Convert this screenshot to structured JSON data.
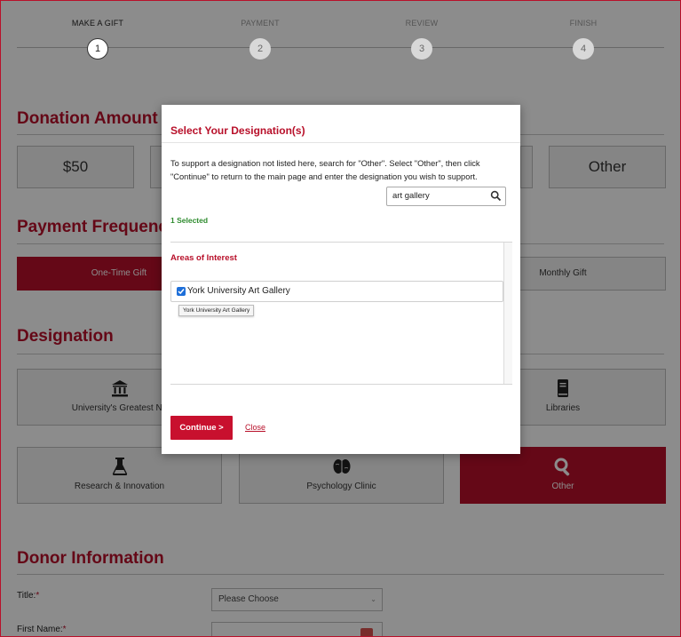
{
  "steps": [
    {
      "label": "MAKE A GIFT",
      "number": "1",
      "state": "active"
    },
    {
      "label": "PAYMENT",
      "number": "2",
      "state": "inactive"
    },
    {
      "label": "REVIEW",
      "number": "3",
      "state": "inactive"
    },
    {
      "label": "FINISH",
      "number": "4",
      "state": "inactive"
    }
  ],
  "donation_amount": {
    "title": "Donation Amount",
    "options": [
      "$50",
      "Other"
    ]
  },
  "payment_frequency": {
    "title": "Payment Frequency",
    "options": [
      "One-Time Gift",
      "Monthly Gift"
    ],
    "selected": "One-Time Gift"
  },
  "designation": {
    "title": "Designation",
    "cards": [
      {
        "label": "University's Greatest Ne",
        "icon": "pillars-icon"
      },
      {
        "label": "Libraries",
        "icon": "book-icon"
      },
      {
        "label": "Research & Innovation",
        "icon": "flask-icon"
      },
      {
        "label": "Psychology Clinic",
        "icon": "brain-icon"
      },
      {
        "label": "Other",
        "icon": "search-icon",
        "selected": true
      }
    ]
  },
  "donor_information": {
    "title": "Donor Information",
    "title_field": {
      "label": "Title:",
      "required": "*",
      "value": "Please Choose"
    },
    "first_name_field": {
      "label": "First Name:",
      "required": "*"
    }
  },
  "modal": {
    "title": "Select Your Designation(s)",
    "description": "To support a designation not listed here, search for \"Other\". Select \"Other\", then click \"Continue\" to return to the main page and enter the designation you wish to support.",
    "search_value": "art gallery",
    "selected_count": "1 Selected",
    "list_heading": "Areas of Interest",
    "list_item": {
      "label": "York University Art Gallery",
      "checked": true
    },
    "tooltip": "York University Art Gallery",
    "continue_label": "Continue >",
    "close_label": "Close"
  },
  "colors": {
    "brand_red": "#b8102a",
    "success_green": "#2e8b2e",
    "checkbox_blue": "#1e6fd9"
  }
}
